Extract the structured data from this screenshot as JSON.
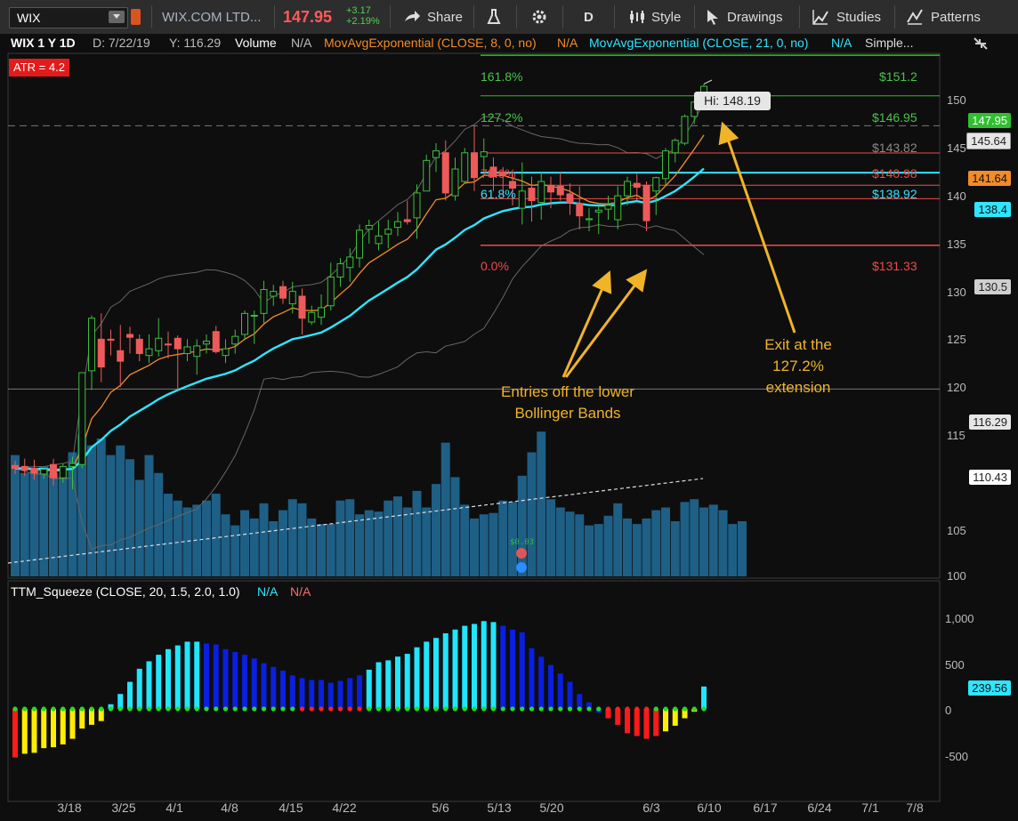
{
  "toolbar": {
    "symbol": "WIX",
    "company": "WIX.COM LTD...",
    "last": "147.95",
    "change": "+3.17",
    "change_pct": "+2.19%",
    "share": "Share",
    "period": "D",
    "style": "Style",
    "drawings": "Drawings",
    "studies": "Studies",
    "patterns": "Patterns",
    "icons": [
      "share-icon",
      "flask-icon",
      "gear-icon",
      "style-icon",
      "cursor-icon",
      "studies-icon",
      "patterns-icon"
    ],
    "colors": {
      "last": "#ff5a5a",
      "change": "#4fd14f"
    }
  },
  "legend": {
    "title": "WIX 1 Y 1D",
    "date": "D: 7/22/19",
    "y": "Y: 116.29",
    "volume": "Volume",
    "volume_val": "N/A",
    "ema8": "MovAvgExponential (CLOSE, 8, 0, no)",
    "ema8_val": "N/A",
    "ema21": "MovAvgExponential (CLOSE, 21, 0, no)",
    "ema21_val": "N/A",
    "more": "Simple...",
    "atr": "ATR = 4.2"
  },
  "squeeze_legend": {
    "label": "TTM_Squeeze (CLOSE, 20, 1.5, 2.0, 1.0)",
    "val1": "N/A",
    "val2": "N/A"
  },
  "fib": {
    "l1618": "161.8%",
    "v1618": "$151.2",
    "l1272": "127.2%",
    "v1272": "$146.95",
    "v1438": "$143.82",
    "l786": "78.6%",
    "v786": "$140.98",
    "l618": "61.8%",
    "v618": "$138.92",
    "l0": "0.0%",
    "v0": "$131.33"
  },
  "hi_label": "Hi: 148.19",
  "dividend": "$0.03",
  "price_badges": [
    "147.95",
    "145.64",
    "141.64",
    "138.4",
    "130.5",
    "116.29",
    "110.43"
  ],
  "price_axis": [
    "150",
    "145",
    "140",
    "135",
    "130",
    "125",
    "120",
    "115",
    "105",
    "100"
  ],
  "osc_axis": [
    "1,000",
    "500",
    "0",
    "-500"
  ],
  "osc_badge": "239.56",
  "dates": [
    "3/18",
    "3/25",
    "4/1",
    "4/8",
    "4/15",
    "4/22",
    "5/6",
    "5/13",
    "5/20",
    "6/3",
    "6/10",
    "6/17",
    "6/24",
    "7/1",
    "7/8"
  ],
  "annotations": {
    "entries": "Entries off the lower Bollinger Bands",
    "exit": "Exit at the 127.2% extension"
  },
  "chart_data": {
    "type": "candlestick",
    "ylim": [
      100,
      153
    ],
    "candles": [
      [
        108.3,
        108.8,
        107.4,
        108.0
      ],
      [
        108.2,
        109.0,
        107.2,
        107.8
      ],
      [
        108.0,
        108.9,
        106.8,
        107.5
      ],
      [
        107.4,
        108.0,
        106.9,
        107.9
      ],
      [
        108.4,
        109.0,
        106.2,
        107.0
      ],
      [
        107.0,
        108.5,
        106.5,
        108.2
      ],
      [
        108.2,
        109.2,
        105.8,
        108.5
      ],
      [
        108.4,
        115.2,
        108.0,
        118.0
      ],
      [
        118.2,
        124.0,
        116.2,
        123.7
      ],
      [
        121.5,
        124.2,
        117.0,
        118.6
      ],
      [
        121.5,
        122.5,
        119.8,
        121.4
      ],
      [
        120.3,
        123.0,
        116.5,
        119.2
      ],
      [
        122.0,
        122.8,
        120.0,
        121.7
      ],
      [
        121.5,
        122.0,
        119.2,
        120.0
      ],
      [
        119.8,
        122.0,
        119.0,
        120.5
      ],
      [
        120.3,
        123.7,
        119.7,
        121.6
      ],
      [
        121.0,
        122.3,
        119.5,
        120.9
      ],
      [
        121.6,
        121.9,
        116.0,
        120.5
      ],
      [
        120.0,
        121.5,
        119.2,
        120.7
      ],
      [
        119.7,
        121.5,
        117.8,
        120.8
      ],
      [
        121.0,
        122.0,
        120.0,
        121.3
      ],
      [
        122.3,
        122.9,
        120.0,
        120.2
      ],
      [
        119.8,
        121.5,
        119.0,
        120.5
      ],
      [
        121.0,
        122.5,
        120.0,
        121.8
      ],
      [
        122.0,
        124.5,
        121.5,
        124.2
      ],
      [
        124.0,
        124.5,
        121.0,
        124.0
      ],
      [
        124.2,
        127.6,
        123.0,
        126.7
      ],
      [
        126.0,
        127.2,
        125.0,
        126.5
      ],
      [
        127.0,
        127.6,
        125.2,
        125.8
      ],
      [
        125.2,
        127.5,
        124.2,
        126.5
      ],
      [
        126.0,
        126.8,
        122.0,
        123.7
      ],
      [
        123.3,
        125.0,
        123.0,
        124.3
      ],
      [
        123.8,
        126.2,
        123.0,
        124.8
      ],
      [
        125.0,
        129.5,
        124.5,
        128.0
      ],
      [
        128.0,
        130.0,
        127.0,
        129.4
      ],
      [
        129.0,
        131.0,
        127.5,
        130.1
      ],
      [
        130.0,
        133.5,
        129.0,
        132.9
      ],
      [
        133.0,
        134.0,
        131.5,
        133.4
      ],
      [
        131.5,
        133.8,
        130.8,
        132.3
      ],
      [
        132.5,
        134.0,
        131.0,
        133.0
      ],
      [
        133.2,
        134.8,
        132.3,
        133.8
      ],
      [
        134.0,
        136.0,
        133.5,
        133.8
      ],
      [
        134.2,
        137.7,
        132.0,
        136.8
      ],
      [
        137.0,
        140.8,
        137.0,
        140.2
      ],
      [
        140.5,
        142.0,
        139.0,
        141.2
      ],
      [
        141.0,
        142.3,
        136.0,
        136.8
      ],
      [
        136.5,
        140.5,
        136.0,
        139.3
      ],
      [
        138.0,
        141.5,
        137.8,
        141.0
      ],
      [
        141.0,
        143.8,
        137.0,
        138.4
      ],
      [
        140.6,
        142.5,
        139.0,
        141.1
      ],
      [
        139.5,
        140.5,
        137.0,
        138.5
      ],
      [
        139.0,
        139.5,
        136.5,
        138.7
      ],
      [
        138.0,
        139.0,
        135.5,
        137.3
      ],
      [
        135.2,
        140.0,
        133.5,
        137.0
      ],
      [
        137.3,
        138.5,
        133.8,
        136.0
      ],
      [
        135.8,
        139.0,
        134.0,
        138.0
      ],
      [
        137.6,
        138.5,
        135.2,
        136.9
      ],
      [
        137.5,
        139.0,
        136.0,
        136.6
      ],
      [
        136.7,
        137.8,
        134.5,
        135.8
      ],
      [
        135.7,
        137.5,
        133.0,
        134.4
      ],
      [
        134.0,
        135.2,
        132.8,
        134.1
      ],
      [
        134.8,
        135.5,
        132.5,
        135.0
      ],
      [
        135.1,
        136.5,
        134.0,
        135.5
      ],
      [
        134.0,
        137.5,
        133.0,
        136.5
      ],
      [
        136.5,
        138.5,
        135.5,
        138.0
      ],
      [
        137.8,
        138.8,
        136.0,
        137.4
      ],
      [
        137.6,
        138.0,
        132.8,
        133.9
      ],
      [
        137.0,
        138.5,
        134.5,
        138.4
      ],
      [
        138.3,
        141.5,
        137.5,
        141.2
      ],
      [
        141.0,
        142.5,
        140.0,
        142.3
      ],
      [
        142.0,
        145.0,
        141.8,
        144.8
      ],
      [
        144.8,
        146.5,
        144.0,
        146.3
      ],
      [
        146.0,
        148.2,
        145.5,
        147.95
      ]
    ],
    "volume_heights": [
      88,
      75,
      78,
      80,
      75,
      72,
      90,
      103,
      95,
      100,
      88,
      95,
      85,
      70,
      88,
      75,
      60,
      55,
      50,
      52,
      55,
      60,
      45,
      37,
      48,
      42,
      53,
      40,
      48,
      56,
      53,
      42,
      38,
      38,
      55,
      56,
      45,
      48,
      47,
      55,
      58,
      50,
      62,
      50,
      67,
      97,
      72,
      52,
      42,
      45,
      46,
      55,
      54,
      73,
      90,
      105,
      56,
      50,
      47,
      45,
      37,
      38,
      44,
      53,
      42,
      38,
      42,
      48,
      50,
      40,
      54,
      56,
      50,
      52,
      48,
      38,
      40
    ],
    "squeeze_values": [
      -520,
      -480,
      -470,
      -420,
      -410,
      -380,
      -320,
      -210,
      -170,
      -130,
      50,
      160,
      290,
      430,
      510,
      580,
      640,
      680,
      720,
      720,
      700,
      690,
      640,
      610,
      580,
      540,
      490,
      450,
      410,
      360,
      330,
      310,
      310,
      280,
      300,
      330,
      360,
      420,
      500,
      520,
      560,
      590,
      660,
      720,
      760,
      810,
      850,
      890,
      910,
      940,
      930,
      890,
      850,
      820,
      650,
      560,
      470,
      380,
      290,
      160,
      70,
      -40,
      -100,
      -170,
      -260,
      -290,
      -320,
      -290,
      -240,
      -180,
      -100,
      -30,
      240
    ],
    "squeeze_colors": [
      "red",
      "yellow",
      "yellow",
      "yellow",
      "yellow",
      "yellow",
      "yellow",
      "yellow",
      "yellow",
      "yellow",
      "cyan",
      "cyan",
      "cyan",
      "cyan",
      "cyan",
      "cyan",
      "cyan",
      "cyan",
      "cyan",
      "cyan",
      "blue",
      "blue",
      "blue",
      "blue",
      "blue",
      "blue",
      "blue",
      "blue",
      "blue",
      "blue",
      "blue",
      "blue",
      "blue",
      "blue",
      "blue",
      "blue",
      "blue",
      "cyan",
      "cyan",
      "cyan",
      "cyan",
      "cyan",
      "cyan",
      "cyan",
      "cyan",
      "cyan",
      "cyan",
      "cyan",
      "cyan",
      "cyan",
      "cyan",
      "blue",
      "blue",
      "blue",
      "blue",
      "blue",
      "blue",
      "blue",
      "blue",
      "blue",
      "blue",
      "blue",
      "red",
      "red",
      "red",
      "red",
      "red",
      "red",
      "yellow",
      "yellow",
      "yellow",
      "yellow",
      "cyan"
    ]
  }
}
